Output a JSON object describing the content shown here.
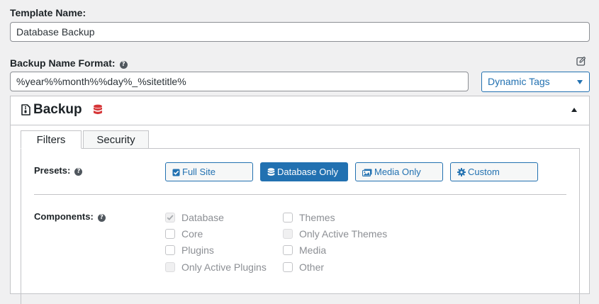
{
  "template_name": {
    "label": "Template Name:",
    "value": "Database Backup"
  },
  "name_format": {
    "label": "Backup Name Format:",
    "value": "%year%%month%%day%_%sitetitle%",
    "help_icon": "help-icon",
    "edit_icon": "pencil-square-icon"
  },
  "dynamic_tags": {
    "selected": "Dynamic Tags"
  },
  "panel": {
    "title": "Backup",
    "title_icon": "file-archive-icon",
    "status_icon": "database-icon",
    "status_color": "#d63638",
    "toggle_icon": "caret-up-icon"
  },
  "tabs": [
    {
      "label": "Filters",
      "active": true
    },
    {
      "label": "Security",
      "active": false
    }
  ],
  "presets": {
    "label": "Presets:",
    "items": [
      {
        "label": "Full Site",
        "icon": "checkbox-icon",
        "selected": false
      },
      {
        "label": "Database Only",
        "icon": "database-icon",
        "selected": true
      },
      {
        "label": "Media Only",
        "icon": "images-icon",
        "selected": false
      },
      {
        "label": "Custom",
        "icon": "gear-icon",
        "selected": false
      }
    ]
  },
  "components": {
    "label": "Components:",
    "items": [
      {
        "label": "Database",
        "checked": true,
        "disabled": true
      },
      {
        "label": "Core",
        "checked": false,
        "disabled": false
      },
      {
        "label": "Plugins",
        "checked": false,
        "disabled": false
      },
      {
        "label": "Only Active Plugins",
        "checked": false,
        "disabled": true
      },
      {
        "label": "Themes",
        "checked": false,
        "disabled": false
      },
      {
        "label": "Only Active Themes",
        "checked": false,
        "disabled": true
      },
      {
        "label": "Media",
        "checked": false,
        "disabled": false
      },
      {
        "label": "Other",
        "checked": false,
        "disabled": false
      }
    ]
  },
  "colors": {
    "accent": "#2271b1",
    "danger": "#d63638"
  }
}
